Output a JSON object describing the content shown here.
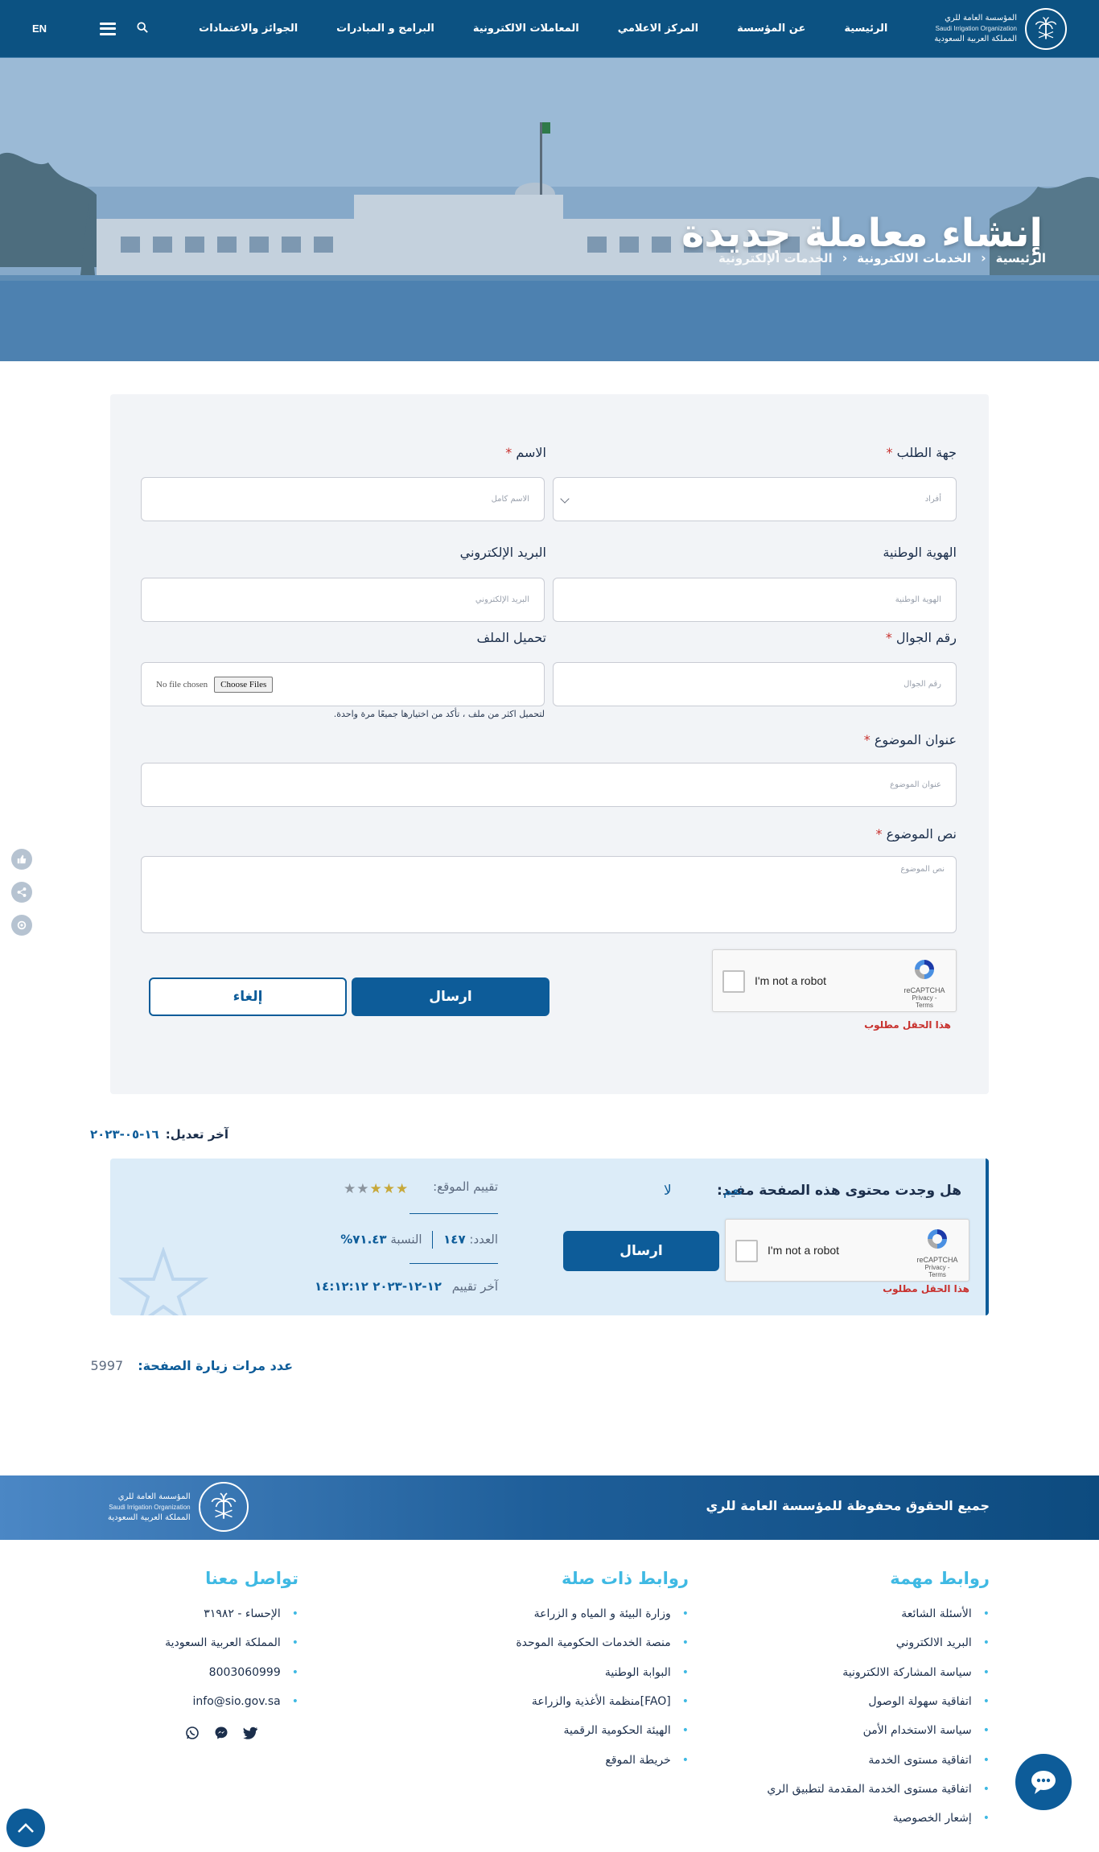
{
  "nav": {
    "logo_ar": "المؤسسة العامة للري",
    "logo_en": "Saudi Irrigation Organization",
    "logo_country": "المملكة العربية السعودية",
    "links": [
      "الرئيسية",
      "عن المؤسسة",
      "المركز الاعلامي",
      "المعاملات الالكترونية",
      "البرامج و المبادرات",
      "الجوائز والاعتمادات"
    ],
    "lang": "EN"
  },
  "hero": {
    "title": "إنشاء معاملة جديدة",
    "breadcrumb": [
      "الرئيسية",
      "الخدمات الالكترونية",
      "الخدمات الإلكترونية"
    ]
  },
  "form": {
    "requester": {
      "label": "جهة الطلب",
      "value": "أفراد"
    },
    "name": {
      "label": "الاسم",
      "placeholder": "الاسم كامل"
    },
    "national_id": {
      "label": "الهوية الوطنية",
      "placeholder": "الهوية الوطنية"
    },
    "email": {
      "label": "البريد الإلكتروني",
      "placeholder": "البريد الإلكتروني"
    },
    "mobile": {
      "label": "رقم الجوال",
      "placeholder": "رقم الجوال"
    },
    "upload": {
      "label": "تحميل الملف",
      "button": "Choose Files",
      "status": "No file chosen",
      "hint": "لتحميل اكثر من ملف ، تأكد من اختيارها جميعًا مرة واحدة."
    },
    "subject": {
      "label": "عنوان الموضوع",
      "placeholder": "عنوان الموضوع"
    },
    "body": {
      "label": "نص الموضوع",
      "placeholder": "نص الموضوع"
    },
    "captcha": {
      "label": "I'm not a robot",
      "brand": "reCAPTCHA",
      "terms": "Privacy - Terms"
    },
    "required_msg": "هذا الحقل مطلوب",
    "submit": "ارسال",
    "cancel": "إلغاء",
    "required_mark": "*"
  },
  "last_modified": {
    "label": "آخر تعديل:",
    "value": "١٦-٠٥-٢٠٢٣"
  },
  "feedback": {
    "question": "هل وجدت محتوى هذه الصفحة مفيد:",
    "yes": "نعم",
    "no": "لا",
    "rating_label": "تقييم الموقع:",
    "rating_value": 3,
    "rating_max": 5,
    "count_label": "العدد:",
    "count_value": "١٤٧",
    "ratio_label": "النسبة",
    "ratio_value": "٧١.٤٣%",
    "last_rating_label": "آخر تقييم",
    "last_rating_value": "١٢-١٢-٢٠٢٣ ١٤:١٢:١٢",
    "submit": "ارسال",
    "captcha_label": "I'm not a robot",
    "captcha_brand": "reCAPTCHA",
    "captcha_terms": "Privacy - Terms",
    "required_msg": "هذا الحقل مطلوب"
  },
  "visits": {
    "label": "عدد مرات زيارة الصفحة:",
    "value": "5997"
  },
  "footer": {
    "rights": "جميع الحقوق محفوظة للمؤسسة العامة للري",
    "important_links_title": "روابط مهمة",
    "important_links": [
      "الأسئلة الشائعة",
      "البريد الالكتروني",
      "سياسة المشاركة الالكترونية",
      "اتفاقية سهولة الوصول",
      "سياسة الاستخدام الأمن",
      "اتفاقية مستوى الخدمة",
      "اتفاقية مستوى الخدمة المقدمة لتطبيق الري",
      "إشعار الخصوصية"
    ],
    "related_links_title": "روابط ذات صلة",
    "related_links": [
      "وزارة البيئة و المياه و الزراعة",
      "منصة الخدمات الحكومية الموحدة",
      "البوابة الوطنية",
      "[FAO]منظمة الأغذية والزراعة",
      "الهيئة الحكومية الرقمية",
      "خريطة الموقع"
    ],
    "contact_title": "تواصل معنا",
    "contact": [
      "الإحساء - ٣١٩٨٢",
      "المملكة العربية السعودية",
      "8003060999",
      "info@sio.gov.sa"
    ],
    "social_icons": [
      "twitter-icon",
      "messenger-icon",
      "whatsapp-icon"
    ]
  },
  "colors": {
    "primary": "#0d5c99",
    "nav_bg": "#0c5282",
    "accent": "#3fb9e3",
    "required": "#c8312e"
  }
}
